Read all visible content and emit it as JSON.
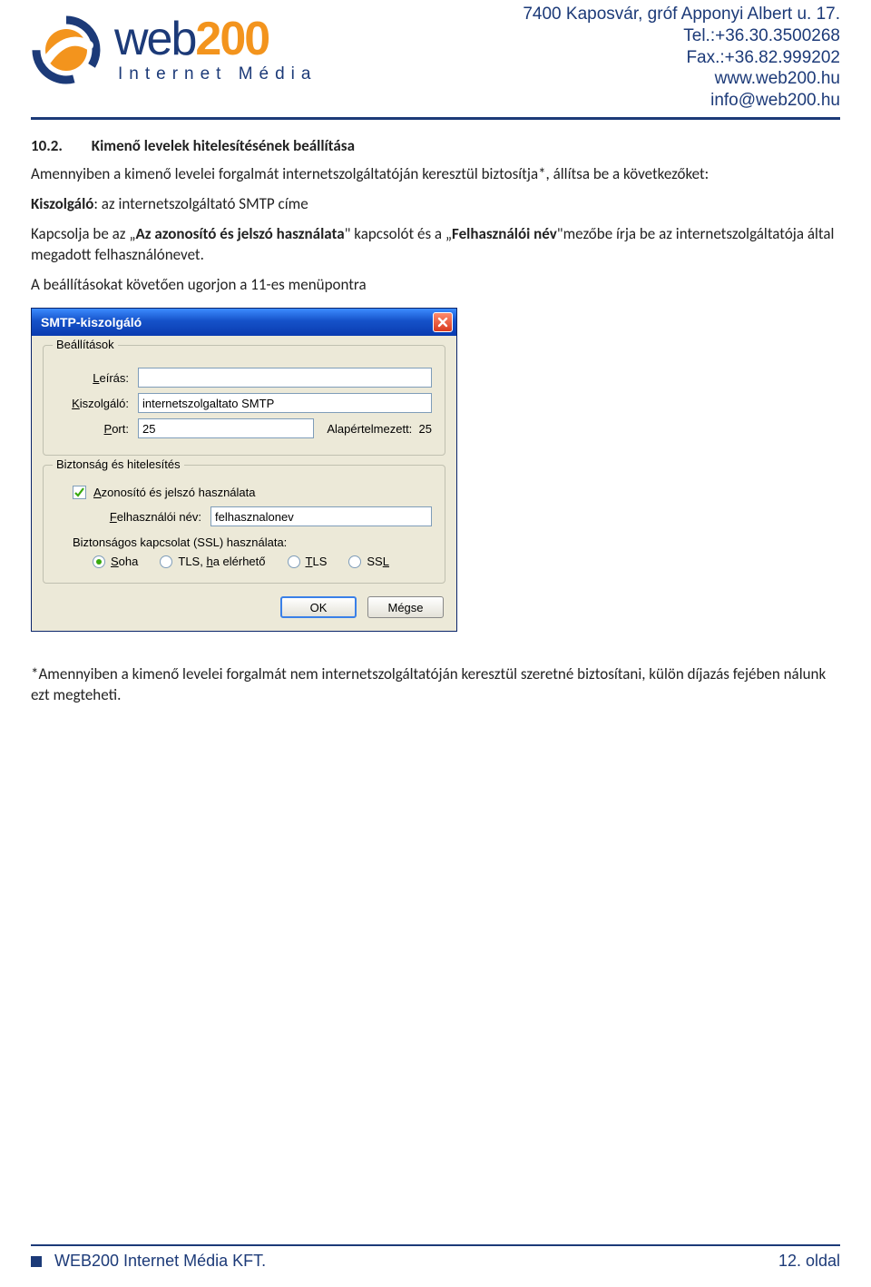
{
  "header": {
    "contact": {
      "line1": "7400 Kaposvár, gróf Apponyi Albert u. 17.",
      "line2": "Tel.:+36.30.3500268",
      "line3": "Fax.:+36.82.999202",
      "line4": "www.web200.hu",
      "line5": "info@web200.hu"
    },
    "logo": {
      "main_a": "web",
      "main_b": "200",
      "sub": "Internet Média"
    }
  },
  "section": {
    "num": "10.2.",
    "title": "Kimenő levelek hitelesítésének beállítása",
    "p1": "Amennyiben a kimenő levelei forgalmát internetszolgáltatóján keresztül biztosítja*, állítsa be a következőket:",
    "p2_label": "Kiszolgáló",
    "p2_rest": ": az internetszolgáltató SMTP címe",
    "p3_a": "Kapcsolja be az „",
    "p3_b": "Az azonosító és jelszó használata",
    "p3_c": "\" kapcsolót és a „",
    "p3_d": "Felhasználói név",
    "p3_e": "\"mezőbe írja be az internetszolgáltatója által megadott felhasználónevet.",
    "p4": "A beállításokat követően ugorjon a 11-es menüpontra"
  },
  "dialog": {
    "title": "SMTP-kiszolgáló",
    "group1": {
      "legend": "Beállítások",
      "desc_label": "Leírás:",
      "desc_value": "",
      "server_label": "Kiszolgáló:",
      "server_value": "internetszolgaltato SMTP",
      "port_label": "Port:",
      "port_value": "25",
      "default_label": "Alapértelmezett:",
      "default_value": "25"
    },
    "group2": {
      "legend": "Biztonság és hitelesítés",
      "auth_label": "Azonosító és jelszó használata",
      "auth_checked": true,
      "user_label": "Felhasználói név:",
      "user_value": "felhasznalonev",
      "ssl_label": "Biztonságos kapcsolat (SSL) használata:",
      "radios": {
        "soha": "Soha",
        "tls_if": "TLS, ha elérhető",
        "tls": "TLS",
        "ssl": "SSL",
        "selected": "soha"
      }
    },
    "ok": "OK",
    "cancel": "Mégse"
  },
  "footnote": "*Amennyiben a kimenő levelei forgalmát nem internetszolgáltatóján keresztül szeretné biztosítani, külön díjazás fejében nálunk ezt megteheti.",
  "footer": {
    "company": "WEB200 Internet Média KFT.",
    "page": "12. oldal"
  }
}
